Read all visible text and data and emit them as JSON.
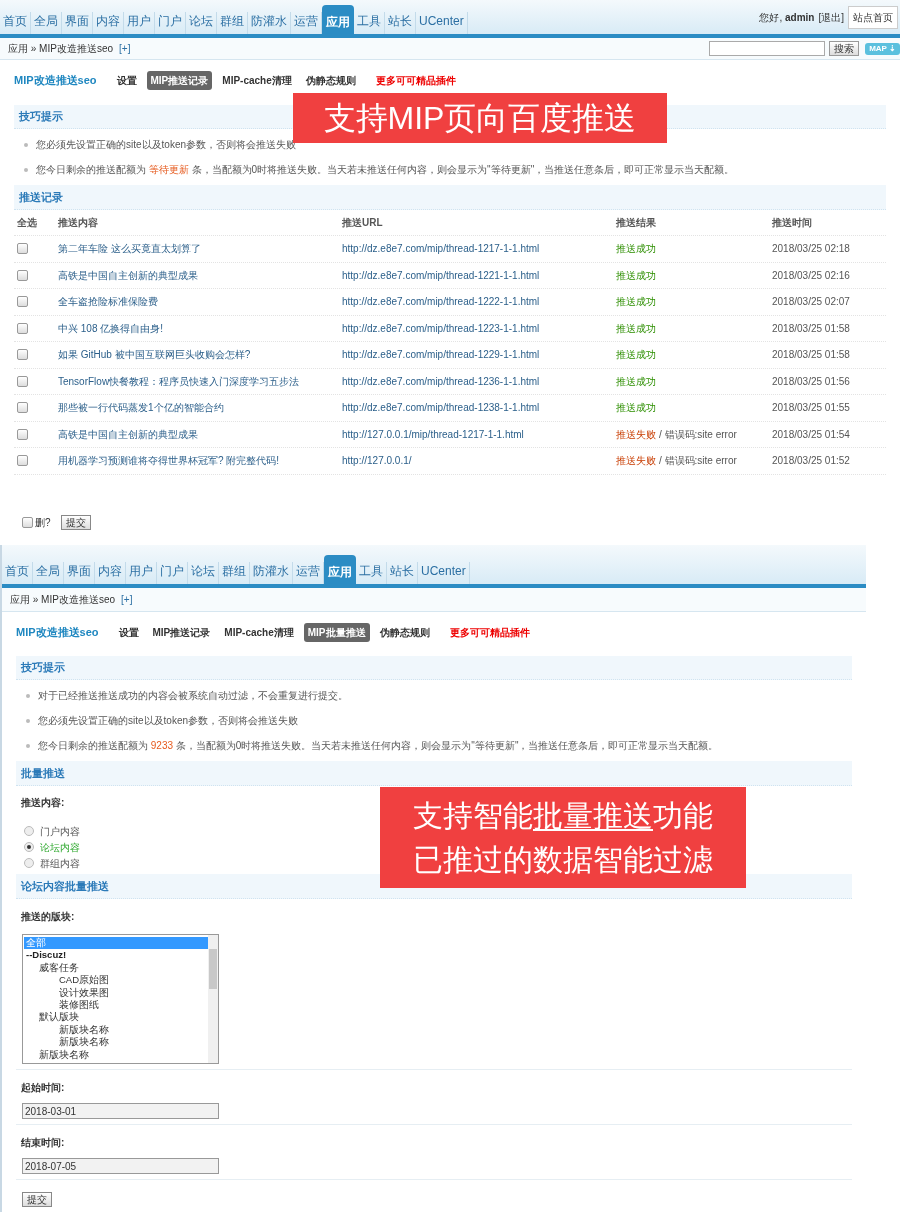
{
  "panel_1": {
    "nav": [
      {
        "label": "首页",
        "selected": false
      },
      {
        "label": "全局",
        "selected": false
      },
      {
        "label": "界面",
        "selected": false
      },
      {
        "label": "内容",
        "selected": false
      },
      {
        "label": "用户",
        "selected": false
      },
      {
        "label": "门户",
        "selected": false
      },
      {
        "label": "论坛",
        "selected": false
      },
      {
        "label": "群组",
        "selected": false
      },
      {
        "label": "防灌水",
        "selected": false
      },
      {
        "label": "运营",
        "selected": false
      },
      {
        "label": "应用",
        "selected": true
      },
      {
        "label": "工具",
        "selected": false
      },
      {
        "label": "站长",
        "selected": false
      },
      {
        "label": "UCenter",
        "selected": false
      }
    ],
    "user": {
      "greeting": "您好,",
      "name": "admin",
      "logout": "[退出]",
      "home": "站点首页"
    },
    "breadcrumb": "应用 » MIP改造推送seo",
    "breadcrumb_add": "[+]",
    "search_button": "搜索",
    "map_button": "MAP ⇣",
    "plugin_title": "MIP改造推送seo",
    "subtabs": [
      {
        "label": "设置",
        "selected": false,
        "kind": "normal"
      },
      {
        "label": "MIP推送记录",
        "selected": true,
        "kind": "normal"
      },
      {
        "label": "MIP-cache清理",
        "selected": false,
        "kind": "normal"
      },
      {
        "label": "伪静态规则",
        "selected": false,
        "kind": "normal"
      },
      {
        "label": "更多可可精品插件",
        "selected": false,
        "kind": "promo"
      }
    ],
    "banner": {
      "lines": [
        [
          {
            "text": "支持MIP页向百度推送",
            "underline": false
          }
        ]
      ]
    },
    "tips_title": "技巧提示",
    "tips": [
      [
        {
          "text": "您必须先设置正确的site以及token参数，否则将会推送失败",
          "highlight": false
        }
      ],
      [
        {
          "text": "您今日剩余的推送配额为 ",
          "highlight": false
        },
        {
          "text": "等待更新",
          "highlight": true
        },
        {
          "text": " 条，当配额为0时将推送失败。当天若未推送任何内容，则会显示为\"等待更新\"，当推送任意条后，即可正常显示当天配额。",
          "highlight": false
        }
      ]
    ],
    "records": {
      "title": "推送记录",
      "columns": [
        "全选",
        "推送内容",
        "推送URL",
        "推送结果",
        "推送时间"
      ],
      "rows": [
        {
          "checked": false,
          "content": "第二年车险 这么买竟直太划算了",
          "url": "http://dz.e8e7.com/mip/thread-1217-1-1.html",
          "result": "推送成功",
          "ok": true,
          "time": "2018/03/25 02:18"
        },
        {
          "checked": false,
          "content": "高铁是中国自主创新的典型成果",
          "url": "http://dz.e8e7.com/mip/thread-1221-1-1.html",
          "result": "推送成功",
          "ok": true,
          "time": "2018/03/25 02:16"
        },
        {
          "checked": false,
          "content": "全车盗抢险标准保险费",
          "url": "http://dz.e8e7.com/mip/thread-1222-1-1.html",
          "result": "推送成功",
          "ok": true,
          "time": "2018/03/25 02:07"
        },
        {
          "checked": false,
          "content": "中兴 108 亿换得自由身!",
          "url": "http://dz.e8e7.com/mip/thread-1223-1-1.html",
          "result": "推送成功",
          "ok": true,
          "time": "2018/03/25 01:58"
        },
        {
          "checked": false,
          "content": "如果 GitHub 被中国互联网巨头收购会怎样?",
          "url": "http://dz.e8e7.com/mip/thread-1229-1-1.html",
          "result": "推送成功",
          "ok": true,
          "time": "2018/03/25 01:58"
        },
        {
          "checked": false,
          "content": "TensorFlow快餐教程：程序员快速入门深度学习五步法",
          "url": "http://dz.e8e7.com/mip/thread-1236-1-1.html",
          "result": "推送成功",
          "ok": true,
          "time": "2018/03/25 01:56"
        },
        {
          "checked": false,
          "content": "那些被一行代码蒸发1个亿的智能合约",
          "url": "http://dz.e8e7.com/mip/thread-1238-1-1.html",
          "result": "推送成功",
          "ok": true,
          "time": "2018/03/25 01:55"
        },
        {
          "checked": false,
          "content": "高铁是中国自主创新的典型成果",
          "url": "http://127.0.0.1/mip/thread-1217-1-1.html",
          "result": "推送失败",
          "ok": false,
          "error": "/ 错误码:site error",
          "time": "2018/03/25 01:54"
        },
        {
          "checked": false,
          "content": "用机器学习预测谁将夺得世界杯冠军? 附完整代码!",
          "url": "http://127.0.0.1/",
          "result": "推送失败",
          "ok": false,
          "error": "/ 错误码:site error",
          "time": "2018/03/25 01:52"
        }
      ]
    },
    "delete": {
      "label": "删?",
      "checked": false
    },
    "submit": "提交"
  },
  "panel_2": {
    "nav": [
      {
        "label": "首页",
        "selected": false
      },
      {
        "label": "全局",
        "selected": false
      },
      {
        "label": "界面",
        "selected": false
      },
      {
        "label": "内容",
        "selected": false
      },
      {
        "label": "用户",
        "selected": false
      },
      {
        "label": "门户",
        "selected": false
      },
      {
        "label": "论坛",
        "selected": false
      },
      {
        "label": "群组",
        "selected": false
      },
      {
        "label": "防灌水",
        "selected": false
      },
      {
        "label": "运营",
        "selected": false
      },
      {
        "label": "应用",
        "selected": true
      },
      {
        "label": "工具",
        "selected": false
      },
      {
        "label": "站长",
        "selected": false
      },
      {
        "label": "UCenter",
        "selected": false
      }
    ],
    "breadcrumb": "应用 » MIP改造推送seo",
    "breadcrumb_add": "[+]",
    "plugin_title": "MIP改造推送seo",
    "subtabs": [
      {
        "label": "设置",
        "selected": false,
        "kind": "normal"
      },
      {
        "label": "MIP推送记录",
        "selected": false,
        "kind": "normal"
      },
      {
        "label": "MIP-cache清理",
        "selected": false,
        "kind": "normal"
      },
      {
        "label": "MIP批量推送",
        "selected": true,
        "kind": "normal"
      },
      {
        "label": "伪静态规则",
        "selected": false,
        "kind": "normal"
      },
      {
        "label": "更多可可精品插件",
        "selected": false,
        "kind": "promo"
      }
    ],
    "banner": {
      "lines": [
        [
          {
            "text": "支持智能",
            "underline": false
          },
          {
            "text": "批量推送",
            "underline": true
          },
          {
            "text": "功能",
            "underline": false
          }
        ],
        [
          {
            "text": "已推过的数据智能过滤",
            "underline": false
          }
        ]
      ]
    },
    "tips_title": "技巧提示",
    "tips": [
      [
        {
          "text": "对于已经推送推送成功的内容会被系统自动过滤，不会重复进行提交。",
          "highlight": false
        }
      ],
      [
        {
          "text": "您必须先设置正确的site以及token参数，否则将会推送失败",
          "highlight": false
        }
      ],
      [
        {
          "text": "您今日剩余的推送配额为 ",
          "highlight": false
        },
        {
          "text": "9233",
          "highlight": true
        },
        {
          "text": " 条，当配额为0时将推送失败。当天若未推送任何内容，则会显示为\"等待更新\"，当推送任意条后，即可正常显示当天配额。",
          "highlight": false
        }
      ]
    ],
    "batch_title": "批量推送",
    "content_label": "推送内容:",
    "content_options": [
      {
        "label": "门户内容",
        "selected": false
      },
      {
        "label": "论坛内容",
        "selected": true
      },
      {
        "label": "群组内容",
        "selected": false
      }
    ],
    "forum_title": "论坛内容批量推送",
    "boards_label": "推送的版块:",
    "boards": [
      {
        "label": "全部",
        "kind": "all",
        "selected": true
      },
      {
        "label": "--Discuz!",
        "kind": "group",
        "selected": false,
        "children": [
          {
            "label": "威客任务",
            "selected": false,
            "children": [
              {
                "label": "CAD原始图",
                "selected": false
              },
              {
                "label": "设计效果图",
                "selected": false
              },
              {
                "label": "装修图纸",
                "selected": false
              }
            ]
          },
          {
            "label": "默认版块",
            "selected": false,
            "children": [
              {
                "label": "新版块名称",
                "selected": false
              },
              {
                "label": "新版块名称",
                "selected": false
              }
            ]
          },
          {
            "label": "新版块名称",
            "selected": false
          }
        ]
      }
    ],
    "start_label": "起始时间:",
    "start_value": "2018-03-01",
    "end_label": "结束时间:",
    "end_value": "2018-07-05",
    "submit": "提交"
  }
}
